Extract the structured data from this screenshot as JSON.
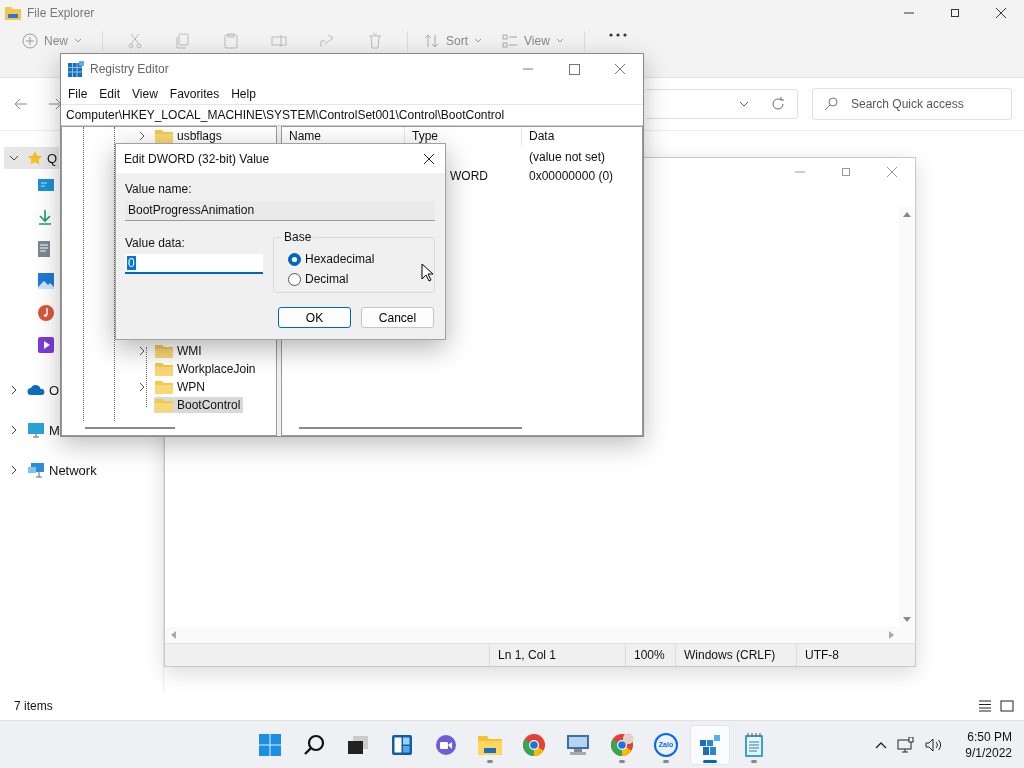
{
  "explorer": {
    "title": "File Explorer",
    "toolbar": {
      "new": "New",
      "sort": "Sort",
      "view": "View"
    },
    "search": {
      "placeholder": "Search Quick access"
    },
    "nav": [
      {
        "label": "Q",
        "kind": "quick",
        "expanded": true,
        "selected": true,
        "children": [
          {
            "kind": "desktop"
          },
          {
            "kind": "downloads"
          },
          {
            "kind": "documents"
          },
          {
            "kind": "pictures"
          },
          {
            "kind": "music"
          },
          {
            "kind": "videos"
          }
        ]
      },
      {
        "label": "O",
        "kind": "cloud",
        "expanded": false,
        "selected": false
      },
      {
        "label": "M",
        "kind": "pc",
        "expanded": false,
        "selected": false
      },
      {
        "label": "Network",
        "kind": "network",
        "expanded": false,
        "selected": false
      }
    ],
    "status": "7 items"
  },
  "notepad": {
    "status": [
      "Ln 1, Col 1",
      "100%",
      "Windows (CRLF)",
      "UTF-8"
    ]
  },
  "regedit": {
    "title": "Registry Editor",
    "menu": [
      "File",
      "Edit",
      "View",
      "Favorites",
      "Help"
    ],
    "address": "Computer\\HKEY_LOCAL_MACHINE\\SYSTEM\\ControlSet001\\Control\\BootControl",
    "tree": [
      {
        "label": "usbflags",
        "expandable": true,
        "selected": false
      },
      {
        "label": "WMI",
        "expandable": true,
        "selected": false
      },
      {
        "label": "WorkplaceJoin",
        "expandable": false,
        "selected": false
      },
      {
        "label": "WPN",
        "expandable": true,
        "selected": false
      },
      {
        "label": "BootControl",
        "expandable": false,
        "selected": true
      }
    ],
    "columns": [
      "Name",
      "Type",
      "Data"
    ],
    "rows": [
      {
        "data": "(value not set)"
      },
      {
        "type": "WORD",
        "data": "0x00000000 (0)"
      }
    ]
  },
  "dialog": {
    "title": "Edit DWORD (32-bit) Value",
    "value_name_label": "Value name:",
    "value_name": "BootProgressAnimation",
    "value_data_label": "Value data:",
    "value_data": "0",
    "base_label": "Base",
    "radios": [
      {
        "label": "Hexadecimal",
        "selected": true
      },
      {
        "label": "Decimal",
        "selected": false
      }
    ],
    "buttons": [
      {
        "label": "OK",
        "default": true
      },
      {
        "label": "Cancel",
        "default": false
      }
    ]
  },
  "taskbar": {
    "apps": [
      {
        "kind": "start",
        "running": false,
        "selected": false
      },
      {
        "kind": "search",
        "running": false,
        "selected": false
      },
      {
        "kind": "taskview",
        "running": false,
        "selected": false
      },
      {
        "kind": "widgets",
        "running": false,
        "selected": false
      },
      {
        "kind": "chat",
        "running": false,
        "selected": false
      },
      {
        "kind": "explorer",
        "running": true,
        "selected": false
      },
      {
        "kind": "chrome",
        "running": false,
        "selected": false
      },
      {
        "kind": "remote",
        "running": false,
        "selected": false
      },
      {
        "kind": "chrome-profile",
        "running": true,
        "selected": false
      },
      {
        "kind": "zalo",
        "label": "Zalo",
        "running": true,
        "selected": false
      },
      {
        "kind": "regedit",
        "running": true,
        "selected": true
      },
      {
        "kind": "notepad",
        "running": true,
        "selected": false
      }
    ],
    "time": "6:50 PM",
    "date": "9/1/2022"
  }
}
